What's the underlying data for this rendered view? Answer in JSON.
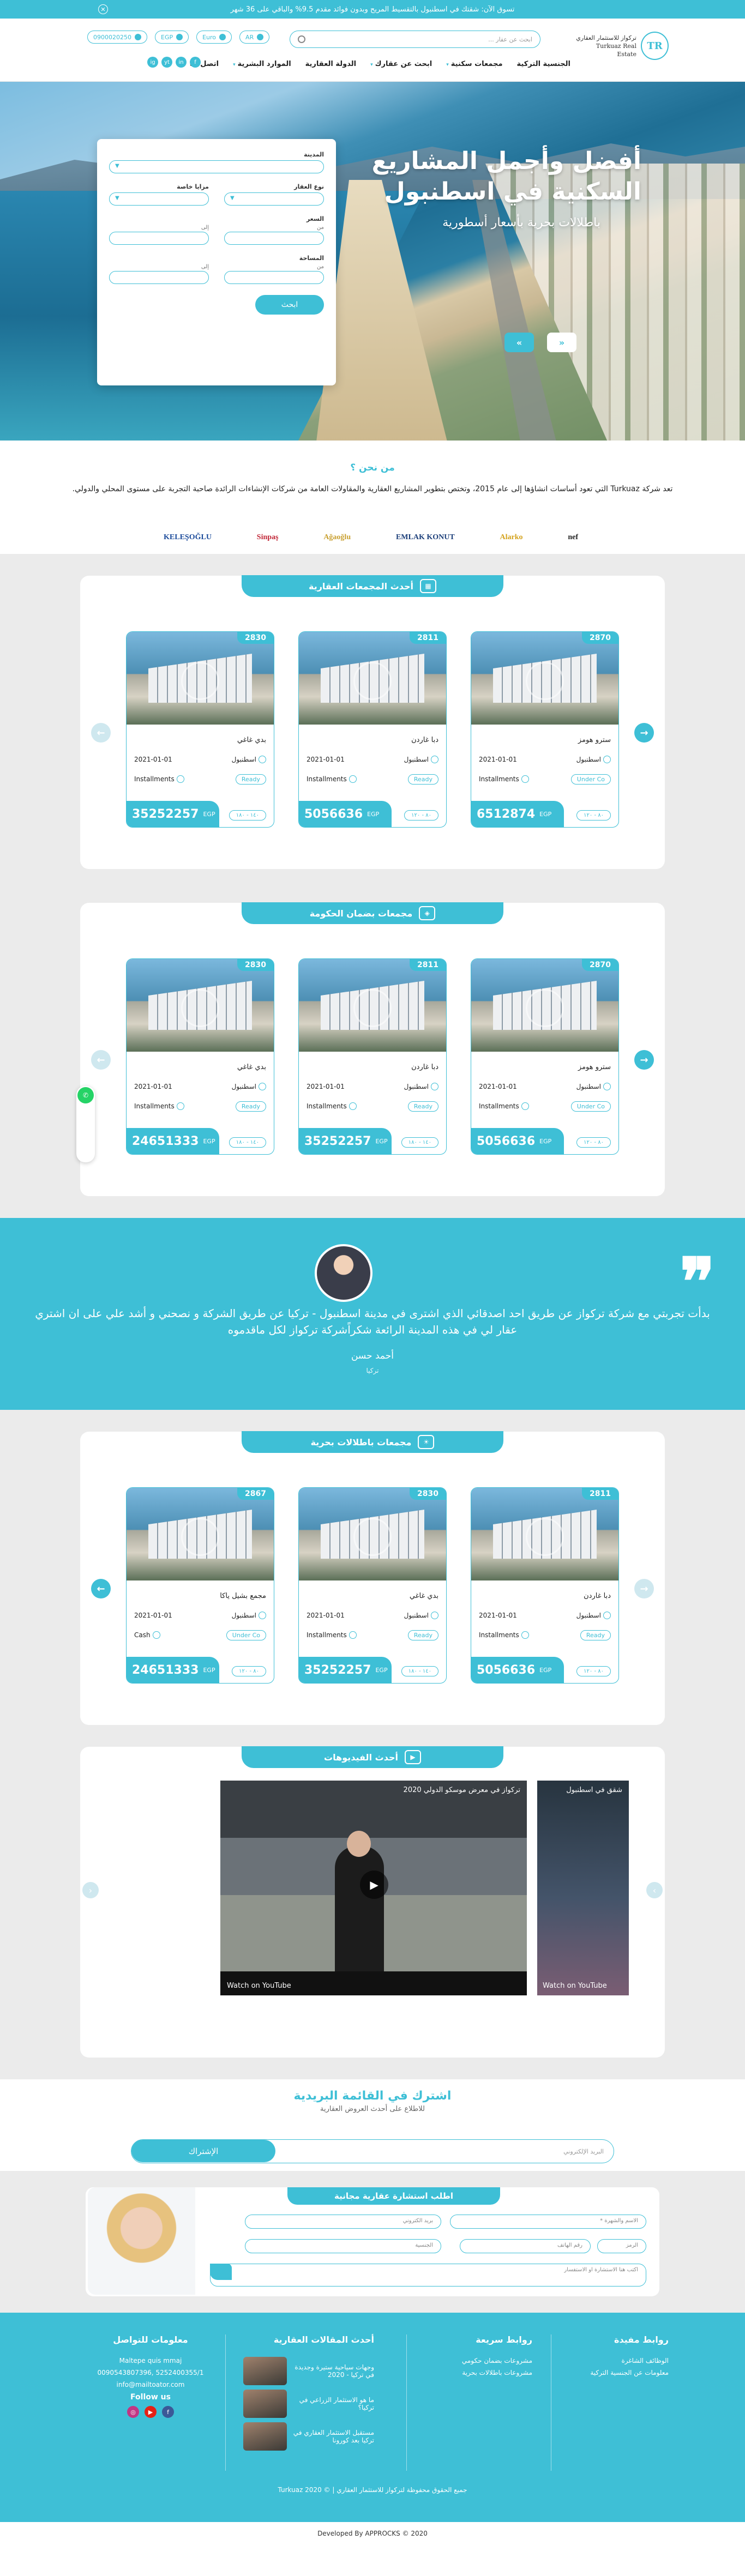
{
  "topbar": {
    "notice": "تسوق الآن: شقتك في اسطنبول بالتقسيط المريح وبدون فوائد مقدم 9.5% والباقي على 36 شهر",
    "close_icon": "close-icon"
  },
  "header": {
    "logo_line1": "تركواز للاستثمار العقاري",
    "logo_line2": "Turkuaz Real Estate",
    "logo_mark": "TR",
    "search_placeholder": "ابحث عن عقار ...",
    "pills": [
      {
        "label": "0900020250"
      },
      {
        "label": "EGP"
      },
      {
        "label": "Euro"
      },
      {
        "label": "AR"
      }
    ],
    "nav": [
      {
        "label": "الجنسية التركية"
      },
      {
        "label": "مجمعات سكنية",
        "caret": "▾"
      },
      {
        "label": "ابحث عن عقارك",
        "caret": "▾"
      },
      {
        "label": "الدولة العقارية"
      },
      {
        "label": "الموارد البشرية",
        "caret": "▾"
      },
      {
        "label": "اتصل بنا"
      }
    ],
    "socials": [
      "f",
      "in",
      "yt",
      "ig"
    ]
  },
  "hero": {
    "title": "أفضل وأجمل المشاريع السكنية في اسطنبول",
    "subtitle": "باطلالات بحرية بأسعار أسطورية",
    "prev_label": "»",
    "next_label": "«"
  },
  "filter": {
    "city_label": "المدينة",
    "type_label": "نوع العقار",
    "feature_label": "مزايا خاصة",
    "price_label": "السعر",
    "from": "من",
    "to": "إلى",
    "area_label": "المساحة",
    "search_button": "ابحث"
  },
  "about": {
    "title": "من نحن ؟",
    "text": "تعد شركة Turkuaz التي تعود أساسات انشاؤها إلى عام 2015، وتختص بتطوير المشاريع العقارية والمقاولات العامة من شركات الإنشاءات الرائدة صاحبة التجربة على مستوى المحلي والدولي.",
    "brands": [
      "nef",
      "Alarko",
      "EMLAK KONUT",
      "Ağaoğlu",
      "Sinpaş",
      "KELEŞOĞLU"
    ]
  },
  "sections": [
    {
      "title": "أحدث المجمعات العقارية",
      "cards": [
        {
          "id": "2870",
          "name": "سترو هومز",
          "city": "اسطنبول",
          "date": "2021-01-01",
          "pay": "Installments",
          "status": "Under Co",
          "price": "6512874",
          "currency": "EGP",
          "area": "٨٠ - ١٢٠"
        },
        {
          "id": "2811",
          "name": "دبا غاردن",
          "city": "اسطنبول",
          "date": "2021-01-01",
          "pay": "Installments",
          "status": "Ready",
          "price": "5056636",
          "currency": "EGP",
          "area": "٨٠ - ١٢٠"
        },
        {
          "id": "2830",
          "name": "بدي غاغي",
          "city": "اسطنبول",
          "date": "2021-01-01",
          "pay": "Installments",
          "status": "Ready",
          "price": "35252257",
          "currency": "EGP",
          "area": "١٤٠ - ١٨٠"
        }
      ]
    },
    {
      "title": "مجمعات بضمان الحكومة",
      "cards": [
        {
          "id": "2870",
          "name": "سترو هومز",
          "city": "اسطنبول",
          "date": "2021-01-01",
          "pay": "Installments",
          "status": "Under Co",
          "price": "5056636",
          "currency": "EGP",
          "area": "٨٠ - ١٢٠"
        },
        {
          "id": "2811",
          "name": "دبا غاردن",
          "city": "اسطنبول",
          "date": "2021-01-01",
          "pay": "Installments",
          "status": "Ready",
          "price": "35252257",
          "currency": "EGP",
          "area": "١٤٠ - ١٨٠"
        },
        {
          "id": "2830",
          "name": "بدي غاغي",
          "city": "اسطنبول",
          "date": "2021-01-01",
          "pay": "Installments",
          "status": "Ready",
          "price": "24651333",
          "currency": "EGP",
          "area": "١٤٠ - ١٨٠"
        }
      ]
    }
  ],
  "testimonial": {
    "text": "بدأت تجربتي مع شركة تركواز عن طريق احد اصدقائي الذي اشترى في مدينة اسطنبول - تركيا عن طريق الشركة و نصحني و أشد علي على ان اشتري عقار لي في هذه المدينة الرائعة شكراًشركة تركواز لكل ماقدموه",
    "name": "أحمد حسن",
    "city": "تركيا",
    "quote": "❞"
  },
  "sea_section": {
    "title": "مجمعات باطلالات بحرية",
    "cards": [
      {
        "id": "2811",
        "name": "دبا غاردن",
        "city": "اسطنبول",
        "date": "2021-01-01",
        "pay": "Installments",
        "status": "Ready",
        "price": "5056636",
        "currency": "EGP",
        "area": "٨٠ - ١٢٠"
      },
      {
        "id": "2830",
        "name": "بدي غاغي",
        "city": "اسطنبول",
        "date": "2021-01-01",
        "pay": "Installments",
        "status": "Ready",
        "price": "35252257",
        "currency": "EGP",
        "area": "١٤٠ - ١٨٠"
      },
      {
        "id": "2867",
        "name": "مجمع بشيل ياكا",
        "city": "اسطنبول",
        "date": "2021-01-01",
        "pay": "Cash",
        "status": "Under Co",
        "price": "24651333",
        "currency": "EGP",
        "area": "٨٠ - ١٢٠"
      }
    ]
  },
  "videos": {
    "title": "أحدث الفيديوهات",
    "video_title": "تركواز في معرض موسكو الدولي 2020",
    "watch_on": "Watch on YouTube",
    "side_title": "شقق في اسطنبول"
  },
  "newsletter": {
    "title": "اشترك في القائمة البريدية",
    "subtitle": "للاطلاع على أحدث العروض العقارية",
    "placeholder": "البريد الإلكتروني",
    "button": "الإشتراك"
  },
  "consult": {
    "title": "اطلب استشارة عقارية مجانية",
    "name_placeholder": "الاسم والشهرة *",
    "email_placeholder": "بريد الكتروني",
    "code_placeholder": "الرمز",
    "phone_placeholder": "رقم الهاتف",
    "country_placeholder": "الجنسية",
    "message_placeholder": "اكتب هنا الاستشارة او الاستفسار"
  },
  "footer": {
    "useful_title": "روابط مفيدة",
    "useful": [
      "الوظائف الشاغرة",
      "معلومات عن الجنسية التركية"
    ],
    "quick_title": "روابط سريعة",
    "quick": [
      "مشروعات بضمان حكومي",
      "مشروعات باطلالات بحرية"
    ],
    "articles_title": "أحدث المقالات العقارية",
    "articles": [
      "وجهات سياحية ستيرة وجديدة في تركيا - 2020",
      "ما هو الاستثمار الزراعي في تركيا؟",
      "مستقبل الاستثمار العقاري في تركيا بعد كورونا"
    ],
    "contact_title": "معلومات للتواصل",
    "address": "Maltepe quis mmaj",
    "phones": "5252400355/1 ,0090543807396",
    "email": "info@mailtoator.com",
    "follow": "Follow us",
    "rights": "جميع الحقوق محفوظة لتركواز للاستثمار العقاري",
    "year": "© 2020 Turkuaz",
    "dev": "Developed By APPROCKS © 2020"
  }
}
